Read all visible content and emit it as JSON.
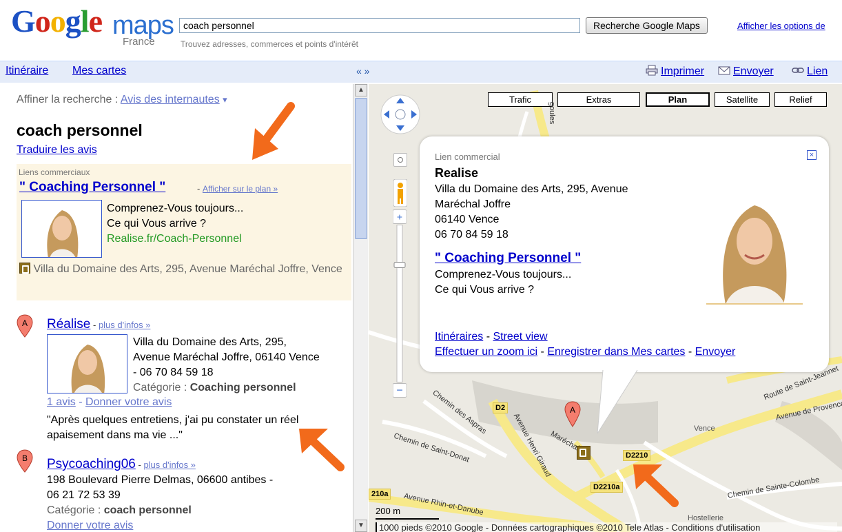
{
  "header": {
    "logo": {
      "g1": "G",
      "o1": "o",
      "o2": "o",
      "g2": "g",
      "l": "l",
      "e": "e"
    },
    "logo_maps": "maps",
    "logo_country": "France",
    "search_value": "coach personnel",
    "search_hint": "Trouvez adresses, commerces et points d'intérêt",
    "search_button": "Recherche Google Maps",
    "search_options": "Afficher les options de"
  },
  "toolbar": {
    "itineraire": "Itinéraire",
    "mes_cartes": "Mes cartes",
    "collapse": "« »",
    "imprimer": "Imprimer",
    "envoyer": "Envoyer",
    "lien": "Lien"
  },
  "panel": {
    "refine_label": "Affiner la recherche : ",
    "refine_link": "Avis des internautes",
    "refine_caret": "▾",
    "query_title": "coach personnel",
    "translate": "Traduire les avis",
    "ad": {
      "label": "Liens commerciaux",
      "title": "\" Coaching Personnel \"",
      "dash": " - ",
      "show_on_map": "Afficher sur le plan »",
      "line1": "Comprenez-Vous toujours...",
      "line2": "Ce qui Vous arrive ?",
      "url": "Realise.fr/Coach-Personnel",
      "address": "Villa du Domaine des Arts, 295, Avenue Maréchal Joffre, Vence"
    },
    "results": [
      {
        "marker": "A",
        "name": "Réalise",
        "dash": " - ",
        "more": "plus d'infos »",
        "addr1": "Villa du Domaine des Arts, 295,",
        "addr2": "Avenue Maréchal Joffre, 06140 Vence",
        "addr3": "- 06 70 84 59 18",
        "category_label": "Catégorie : ",
        "category": "Coaching personnel",
        "reviews": "1 avis",
        "reviews_dash": " - ",
        "give_review": "Donner votre avis",
        "quote": "\"Après quelques entretiens, j'ai pu constater un réel apaisement dans ma vie ...\""
      },
      {
        "marker": "B",
        "name": "Psycoaching06",
        "dash": " - ",
        "more": "plus d'infos »",
        "addr1": "198 Boulevard Pierre Delmas, 06600 antibes -",
        "addr2": "06 21 72 53 39",
        "category_label": "Catégorie : ",
        "category": "coach personnel",
        "give_review": "Donner votre avis"
      }
    ]
  },
  "map": {
    "buttons": [
      "Trafic",
      "Extras",
      "Plan",
      "Satellite",
      "Relief"
    ],
    "selected_button": "Plan",
    "infowindow": {
      "label": "Lien commercial",
      "name": "Realise",
      "addr1": "Villa du Domaine des Arts, 295, Avenue",
      "addr2": "Maréchal Joffre",
      "addr3": "06140 Vence",
      "phone": "06 70 84 59 18",
      "ad_title": "\" Coaching Personnel \"",
      "line1": "Comprenez-Vous toujours...",
      "line2": "Ce qui Vous arrive ?",
      "link_itineraires": "Itinéraires",
      "link_streetview": "Street view",
      "link_zoom": "Effectuer un zoom ici",
      "link_save": "Enregistrer dans Mes cartes",
      "link_send": "Envoyer",
      "sep": " - ",
      "close": "×"
    },
    "road_labels": {
      "d2": "D2",
      "d2210a": "D2210",
      "d2210b": "D2210a",
      "chemin_aspras": "Chemin des Aspras",
      "chemin_donat": "Chemin de Saint-Donat",
      "av_giraud": "Avenue Henri Giraud",
      "av_joffre": "Maréchal",
      "av_rhin": "Avenue Rhin-et-Danube",
      "av_provence": "Avenue de Provence",
      "route_jeannet": "Route de Saint-Jeannet",
      "chemin_colombe": "Chemin de Sainte-Colombe",
      "vence": "Vence",
      "hostellerie": "Hostellerie",
      "goulet": "goules",
      "d210a": "210a"
    },
    "marker_a": "A",
    "scale_m": "200 m",
    "scale_ft": "1000 pieds",
    "copyright": "©2010 Google - Données cartographiques ©2010 Tele Atlas - Conditions d'utilisation"
  },
  "colors": {
    "link": "#0000cc",
    "annotation_arrow": "#f26a1b",
    "toolbar_bg": "#e5ecf9",
    "ad_bg": "#fcf5e3"
  }
}
